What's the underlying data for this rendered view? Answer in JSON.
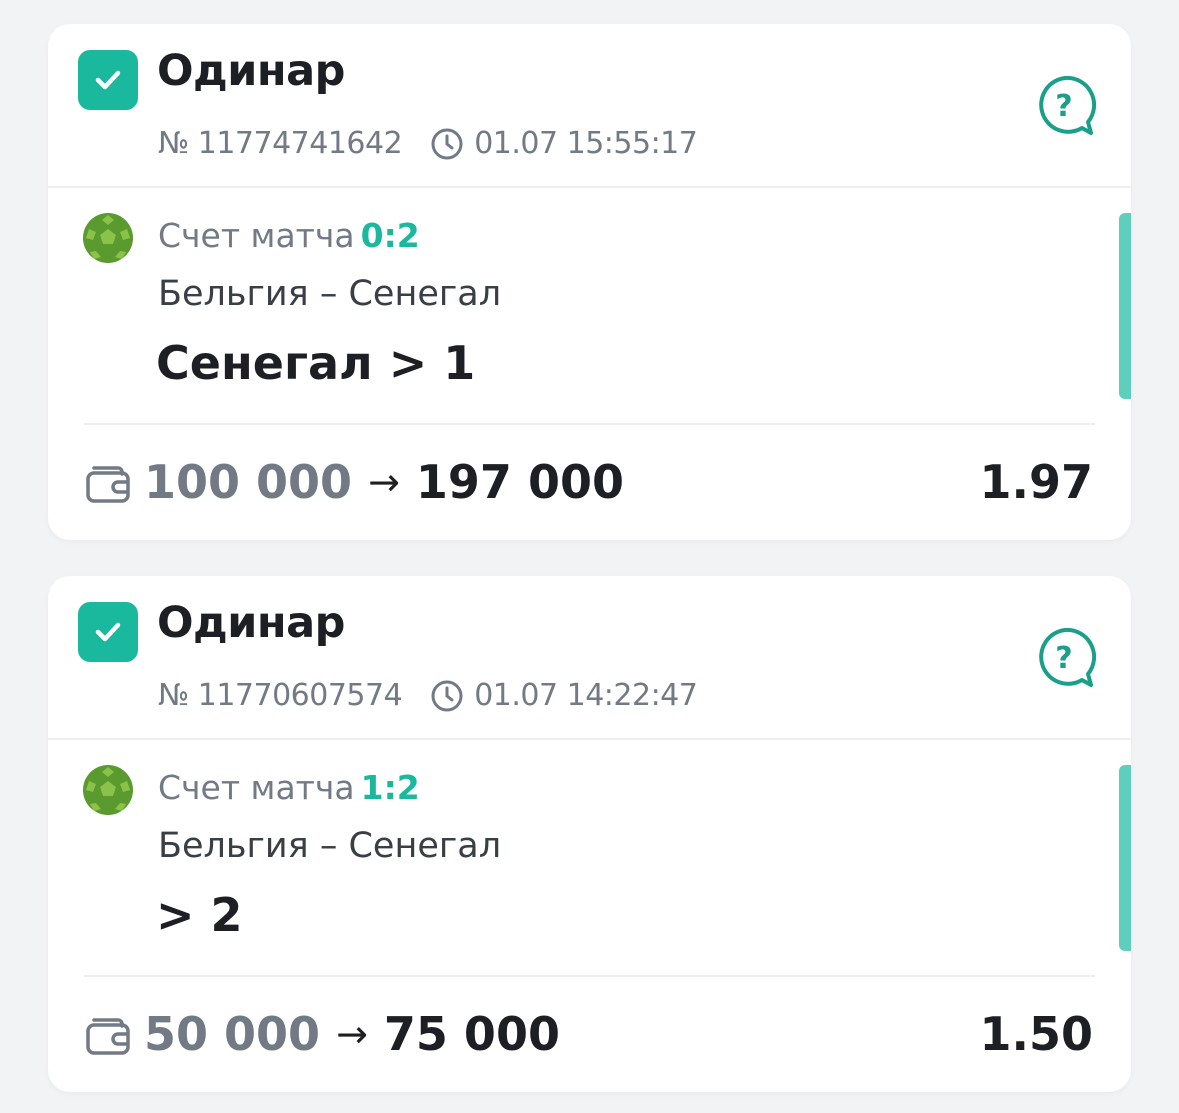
{
  "bets": [
    {
      "type_label": "Одинар",
      "number": "№ 11774741642",
      "datetime": "01.07 15:55:17",
      "score_label": "Счет матча",
      "score": "0:2",
      "match": "Бельгия – Сенегал",
      "selection": "Сенегал > 1",
      "stake": "100 000",
      "arrow": "→",
      "payout": "197 000",
      "coefficient": "1.97"
    },
    {
      "type_label": "Одинар",
      "number": "№ 11770607574",
      "datetime": "01.07 14:22:47",
      "score_label": "Счет матча",
      "score": "1:2",
      "match": "Бельгия – Сенегал",
      "selection": "> 2",
      "stake": "50 000",
      "arrow": "→",
      "payout": "75 000",
      "coefficient": "1.50"
    }
  ],
  "colors": {
    "accent": "#1ab89c",
    "accent_bar": "#5fcfbd",
    "ball": "#5a9a2e",
    "text_dark": "#1d1f24",
    "text_muted": "#727a85"
  },
  "icons": {
    "check": "checkbox-checked-icon",
    "clock": "clock-icon",
    "help": "help-chat-icon",
    "sport": "football-icon",
    "wallet": "wallet-icon"
  }
}
